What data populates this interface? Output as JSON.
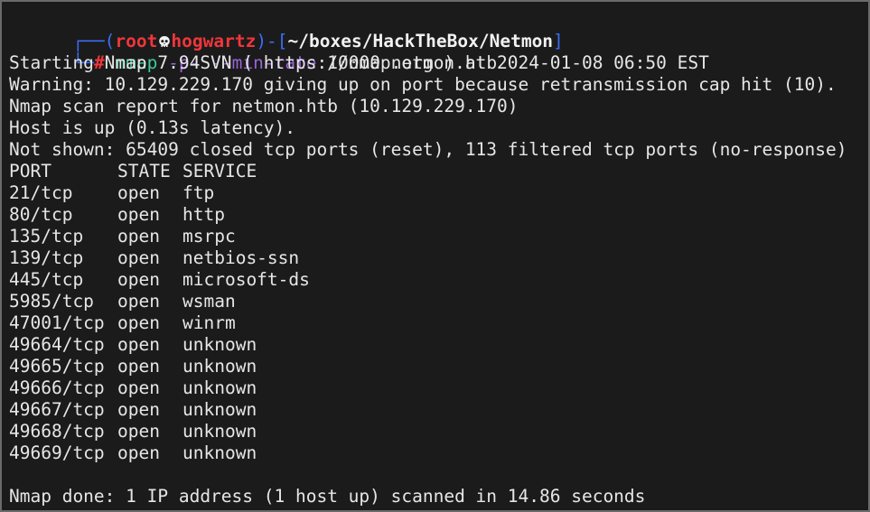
{
  "prompt": {
    "box_open": "┌──(",
    "user": "root",
    "skull_icon": "skull-icon",
    "host": "hogwartz",
    "mid": ")-[",
    "path": "~/boxes/HackTheBox/Netmon",
    "box_close": "]",
    "line2_prefix": "└─",
    "hash": "#",
    "cmd": "nmap",
    "flag1": "-p-",
    "flag2": "--min-rate",
    "args": "10000 netmon.htb"
  },
  "output": [
    "Starting Nmap 7.94SVN ( https://nmap.org ) at 2024-01-08 06:50 EST",
    "Warning: 10.129.229.170 giving up on port because retransmission cap hit (10).",
    "Nmap scan report for netmon.htb (10.129.229.170)",
    "Host is up (0.13s latency).",
    "Not shown: 65409 closed tcp ports (reset), 113 filtered tcp ports (no-response)"
  ],
  "table": {
    "headers": [
      "PORT",
      "STATE",
      "SERVICE"
    ],
    "rows": [
      [
        "21/tcp",
        "open",
        "ftp"
      ],
      [
        "80/tcp",
        "open",
        "http"
      ],
      [
        "135/tcp",
        "open",
        "msrpc"
      ],
      [
        "139/tcp",
        "open",
        "netbios-ssn"
      ],
      [
        "445/tcp",
        "open",
        "microsoft-ds"
      ],
      [
        "5985/tcp",
        "open",
        "wsman"
      ],
      [
        "47001/tcp",
        "open",
        "winrm"
      ],
      [
        "49664/tcp",
        "open",
        "unknown"
      ],
      [
        "49665/tcp",
        "open",
        "unknown"
      ],
      [
        "49666/tcp",
        "open",
        "unknown"
      ],
      [
        "49667/tcp",
        "open",
        "unknown"
      ],
      [
        "49668/tcp",
        "open",
        "unknown"
      ],
      [
        "49669/tcp",
        "open",
        "unknown"
      ]
    ]
  },
  "footer": "Nmap done: 1 IP address (1 host up) scanned in 14.86 seconds",
  "colors": {
    "background": "#1b1b1b",
    "border": "#6a6a6a",
    "prompt_frame": "#3b6df5",
    "user_host": "#f0363c",
    "command": "#3ec99a",
    "flags": "#9a63d8",
    "text": "#e6e6e6"
  }
}
